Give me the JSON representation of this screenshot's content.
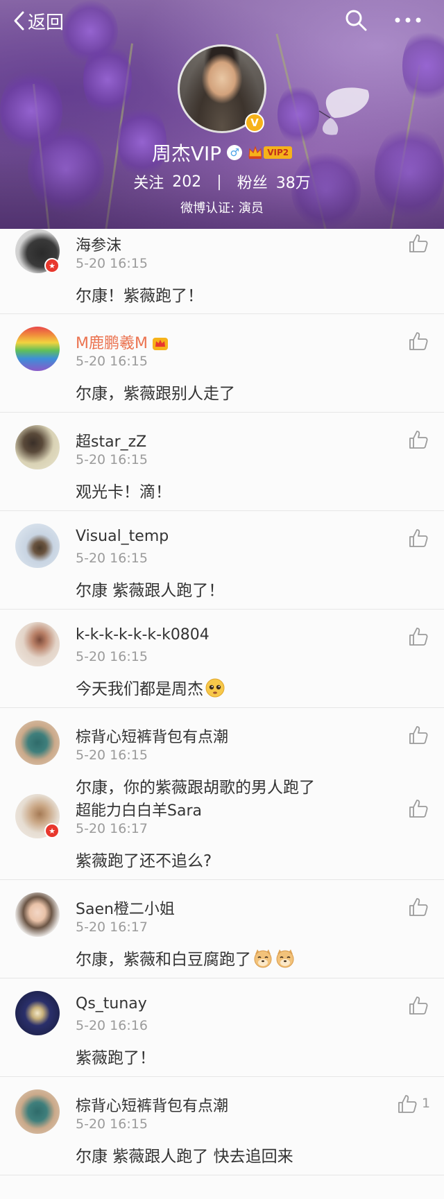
{
  "nav": {
    "back_label": "返回"
  },
  "profile": {
    "name": "周杰VIP",
    "vip_label": "VIP2",
    "following_label": "关注",
    "following_count": "202",
    "followers_label": "粉丝",
    "followers_count": "38万",
    "verification": "微博认证: 演员"
  },
  "comments": [
    {
      "name": "海参沫",
      "time": "5-20 16:15",
      "text": "尔康！紫薇跑了！"
    },
    {
      "name": "M鹿鹏羲M",
      "time": "5-20 16:15",
      "text": "尔康，紫薇跟别人走了"
    },
    {
      "name": "超star_zZ",
      "time": "5-20 16:15",
      "text": "观光卡！滴！"
    },
    {
      "name": "Visual_temp",
      "time": "5-20 16:15",
      "text": "尔康 紫薇跟人跑了！"
    },
    {
      "name": "k-k-k-k-k-k-k0804",
      "time": "5-20 16:15",
      "text": "今天我们都是周杰"
    },
    {
      "name": "棕背心短裤背包有点潮",
      "time": "5-20 16:15",
      "text": "尔康，你的紫薇跟胡歌的男人跑了"
    },
    {
      "name": "超能力白白羊Sara",
      "time": "5-20 16:17",
      "text": "紫薇跑了还不追么?"
    },
    {
      "name": "Saen橙二小姐",
      "time": "5-20 16:17",
      "text": "尔康，紫薇和白豆腐跑了"
    },
    {
      "name": "Qs_tunay",
      "time": "5-20 16:16",
      "text": "紫薇跑了！"
    },
    {
      "name": "棕背心短裤背包有点潮",
      "time": "5-20 16:15",
      "text": "尔康 紫薇跟人跑了 快去追回来",
      "likes": "1"
    }
  ],
  "colors": {
    "accent_orange": "#eb7350",
    "vip_gold": "#f6b21a",
    "member_red": "#e8372d",
    "gender_blue": "#4aa3e8"
  },
  "icons": {
    "back": "chevron-left-icon",
    "search": "search-icon",
    "more": "more-dots-icon",
    "like": "thumbs-up-icon"
  }
}
